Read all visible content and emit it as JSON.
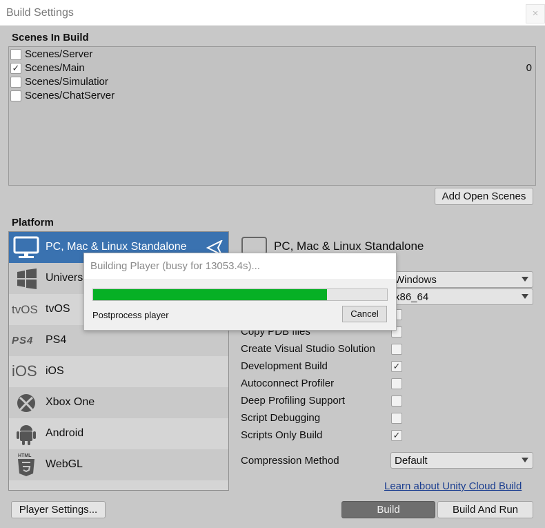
{
  "window": {
    "title": "Build Settings",
    "close_glyph": "×"
  },
  "scenes": {
    "heading": "Scenes In Build",
    "items": [
      {
        "name": "Scenes/Server",
        "checked": false,
        "index": ""
      },
      {
        "name": "Scenes/Main",
        "checked": true,
        "index": "0"
      },
      {
        "name": "Scenes/Simulatior",
        "checked": false,
        "index": ""
      },
      {
        "name": "Scenes/ChatServer",
        "checked": false,
        "index": ""
      }
    ],
    "add_open_scenes": "Add Open Scenes"
  },
  "platform": {
    "heading": "Platform",
    "items": [
      {
        "label": "PC, Mac & Linux Standalone",
        "icon": "monitor-icon",
        "selected": true
      },
      {
        "label": "Universal Windows Platform",
        "icon": "windows-logo-icon",
        "selected": false
      },
      {
        "label": "tvOS",
        "icon": "tvos-icon",
        "icon_text": "tvOS",
        "selected": false
      },
      {
        "label": "PS4",
        "icon": "ps4-icon",
        "icon_text": "PS4",
        "selected": false
      },
      {
        "label": "iOS",
        "icon": "ios-icon",
        "icon_text": "iOS",
        "selected": false
      },
      {
        "label": "Xbox One",
        "icon": "xbox-icon",
        "selected": false
      },
      {
        "label": "Android",
        "icon": "android-icon",
        "selected": false
      },
      {
        "label": "WebGL",
        "icon": "html5-icon",
        "icon_text": "HTML",
        "selected": false
      }
    ]
  },
  "settings": {
    "title": "PC, Mac & Linux Standalone",
    "target_platform_value": "Windows",
    "architecture_value": "x86_64",
    "copy_pdb_label": "Copy PDB files",
    "options": [
      {
        "label": "Create Visual Studio Solution",
        "checked": false
      },
      {
        "label": "Development Build",
        "checked": true
      },
      {
        "label": "Autoconnect Profiler",
        "checked": false
      },
      {
        "label": "Deep Profiling Support",
        "checked": false
      },
      {
        "label": "Script Debugging",
        "checked": false
      },
      {
        "label": "Scripts Only Build",
        "checked": true
      }
    ],
    "compression_label": "Compression Method",
    "compression_value": "Default",
    "cloud_link": "Learn about Unity Cloud Build"
  },
  "footer": {
    "player_settings": "Player Settings...",
    "build": "Build",
    "build_and_run": "Build And Run"
  },
  "progress_dialog": {
    "title": "Building Player (busy for 13053.4s)...",
    "status": "Postprocess player",
    "cancel": "Cancel",
    "progress": 0.795,
    "color": "#06b025"
  },
  "colors": {
    "selection": "#3a72b0",
    "window_bg": "#c8c8c8"
  }
}
